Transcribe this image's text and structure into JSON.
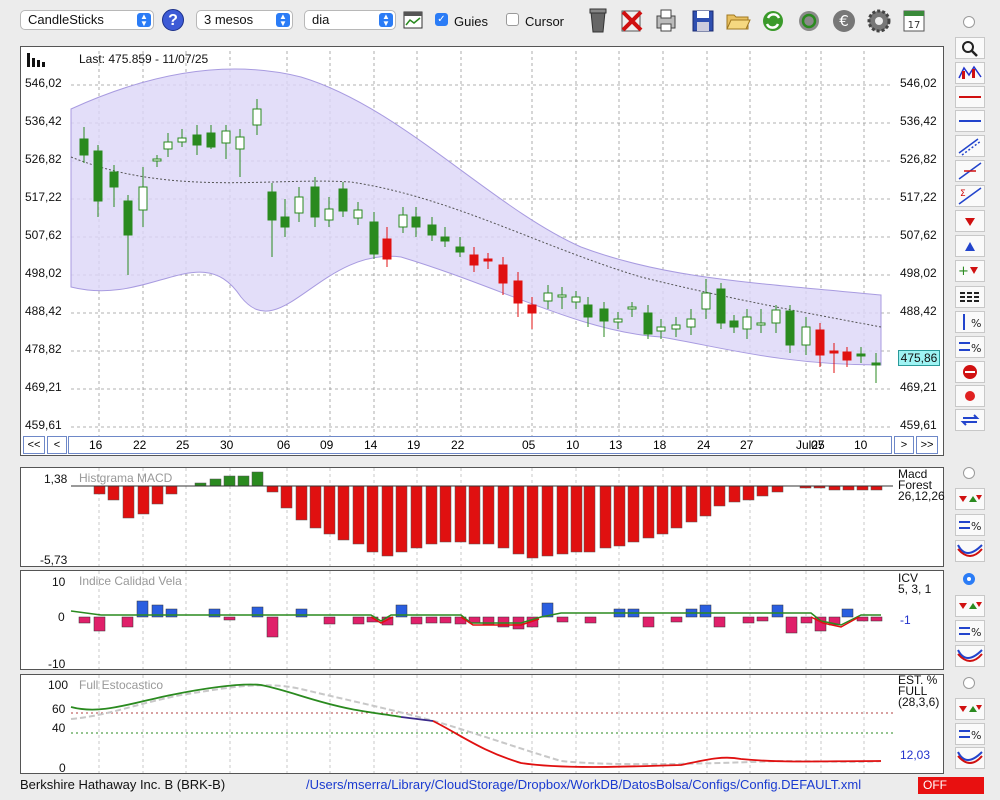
{
  "toolbar": {
    "chart_type": "CandleSticks",
    "period": "3 mesos",
    "interval": "dia",
    "guies_label": "Guies",
    "guies_checked": true,
    "cursor_label": "Cursor",
    "cursor_checked": false
  },
  "main_chart": {
    "last_label": "Last: 475.859 - 11/07/25",
    "current_price": "475,86",
    "y_ticks": [
      "546,02",
      "536,42",
      "526,82",
      "517,22",
      "507,62",
      "498,02",
      "488,42",
      "478,82",
      "469,21",
      "459,61"
    ],
    "x_ticks": [
      "16",
      "22",
      "25",
      "30",
      "06",
      "09",
      "14",
      "19",
      "22",
      "05",
      "10",
      "13",
      "18",
      "24",
      "27",
      "Jul25",
      "07",
      "10"
    ],
    "nav_buttons": {
      "first": "<<",
      "prev": "<",
      "next": ">",
      "last": ">>"
    }
  },
  "macd": {
    "title": "Histgrama MACD",
    "label_line1": "Macd",
    "label_line2": "Forest",
    "label_line3": "26,12,26",
    "y_max": "1,38",
    "y_min": "-5,73"
  },
  "icv": {
    "title": "Indice Calidad Vela",
    "label_line1": "ICV",
    "label_line2": "5, 3, 1",
    "value": "-1",
    "y_ticks": [
      "10",
      "0",
      "-10"
    ]
  },
  "stoch": {
    "title": "Full Estocastico",
    "label_line1": "EST. %",
    "label_line2": "FULL",
    "label_line3": "(28,3,6)",
    "value": "12,03",
    "y_ticks": [
      "100",
      "60",
      "40",
      "0"
    ]
  },
  "footer": {
    "instrument": "Berkshire Hathaway Inc. B (BRK-B)",
    "config_path": "/Users/mserra/Library/CloudStorage/Dropbox/WorkDB/DatosBolsa/Configs/Config.DEFAULT.xml",
    "status": "OFF"
  },
  "colors": {
    "up": "#2a8a1f",
    "down": "#e01010",
    "band": "#dcd6f7",
    "accent": "#2b7cf6"
  },
  "chart_data": {
    "type": "candlestick",
    "x": [
      "16",
      "22",
      "25",
      "30",
      "06",
      "09",
      "14",
      "19",
      "22",
      "05",
      "10",
      "13",
      "18",
      "24",
      "27",
      "Jul25",
      "07",
      "10"
    ],
    "ylim": [
      459.61,
      546.02
    ],
    "last": 475.859
  }
}
